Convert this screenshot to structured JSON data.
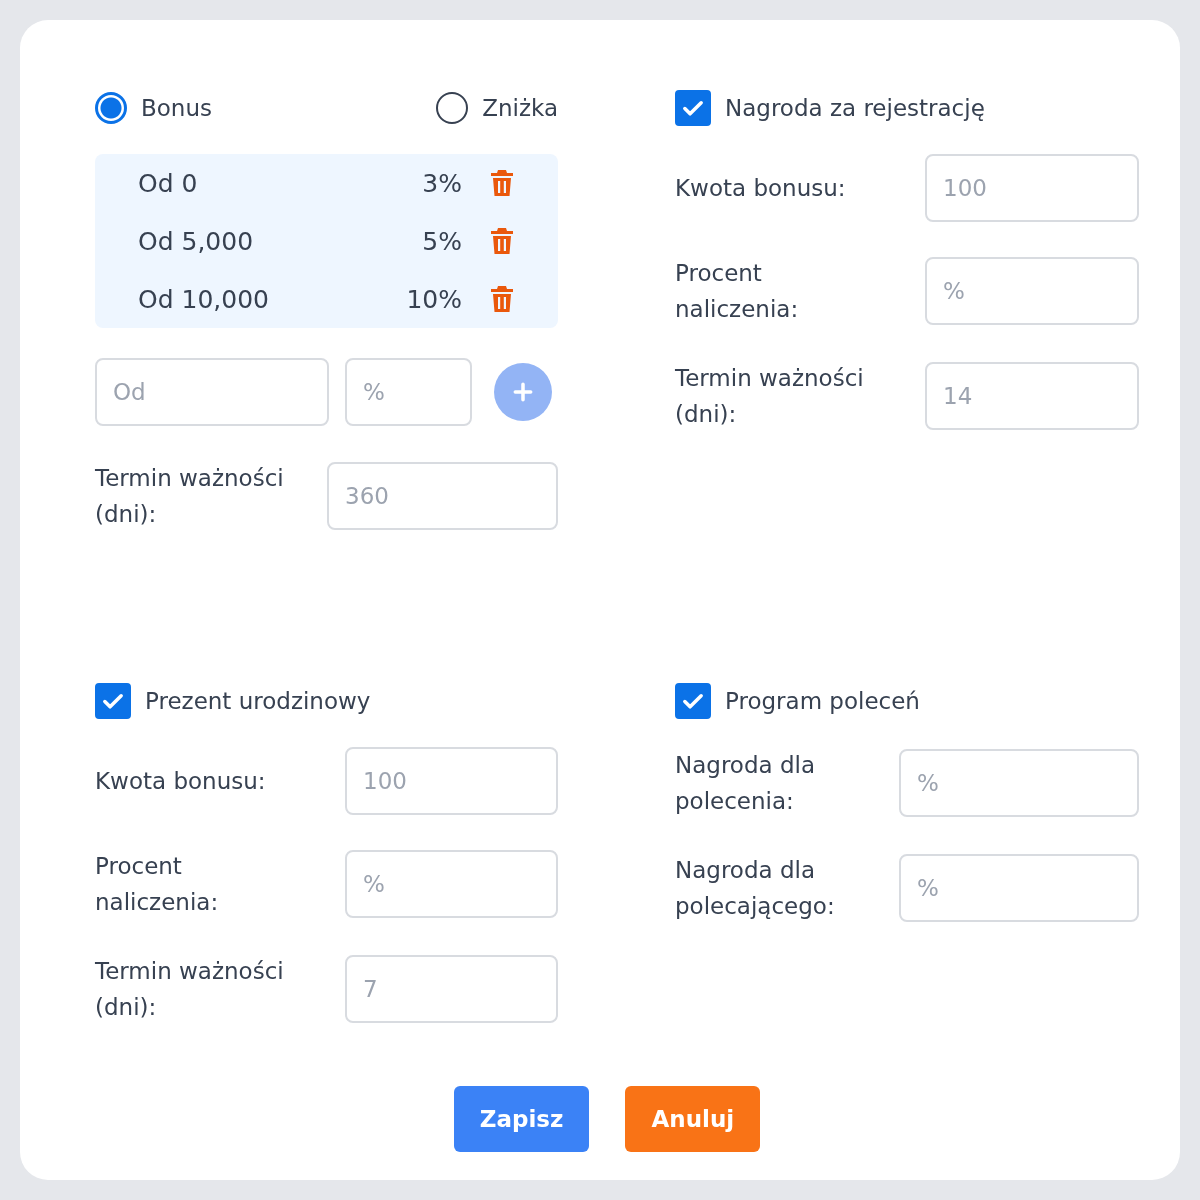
{
  "discount_type": [
    {
      "label": "Bonus",
      "selected": true
    },
    {
      "label": "Zniżka",
      "selected": false
    }
  ],
  "tiers": [
    {
      "from": "Od 0",
      "percent": "3%"
    },
    {
      "from": "Od 5,000",
      "percent": "5%"
    },
    {
      "from": "Od 10,000",
      "percent": "10%"
    }
  ],
  "new_tier": {
    "from": {
      "placeholder": "Od"
    },
    "percent": {
      "placeholder": "%"
    }
  },
  "bonus_expiry": {
    "label": "Termin ważności (dni):",
    "placeholder": "360"
  },
  "sections": [
    {
      "label": "Nagroda za rejestrację",
      "checked": true,
      "fields": [
        {
          "label": "Kwota bonusu:",
          "placeholder": "100"
        },
        {
          "label": "Procent naliczenia:",
          "placeholder": "%"
        },
        {
          "label": "Termin ważności (dni):",
          "placeholder": "14"
        }
      ]
    },
    {
      "label": "Prezent urodzinowy",
      "checked": true,
      "fields": [
        {
          "label": "Kwota bonusu:",
          "placeholder": "100"
        },
        {
          "label": "Procent naliczenia:",
          "placeholder": "%"
        },
        {
          "label": "Termin ważności (dni):",
          "placeholder": "7"
        }
      ]
    },
    {
      "label": "Program poleceń",
      "checked": true,
      "fields": [
        {
          "label": "Nagroda dla polecenia:",
          "placeholder": "%"
        },
        {
          "label": "Nagroda dla polecającego:",
          "placeholder": "%"
        }
      ]
    }
  ],
  "buttons": [
    {
      "label": "Zapisz",
      "kind": "primary"
    },
    {
      "label": "Anuluj",
      "kind": "cancel"
    }
  ]
}
